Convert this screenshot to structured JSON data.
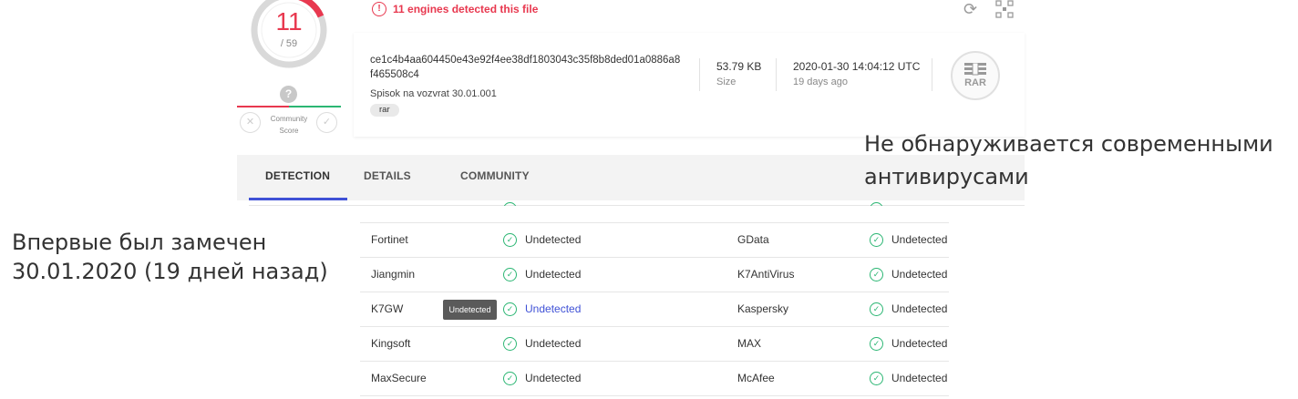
{
  "score": {
    "detected": "11",
    "total": "/ 59",
    "color": "#e8384f"
  },
  "community": {
    "icon": "question-icon",
    "label_line1": "Community",
    "label_line2": "Score"
  },
  "alert": {
    "text": "11 engines detected this file",
    "color": "#e8384f"
  },
  "file": {
    "hash_line1": "ce1c4b4aa604450e43e92f4ee38df1803043c35f8b8ded01a0886a8",
    "hash_line2": "f465508c4",
    "name": "Spisok na vozvrat 30.01.001",
    "tag": "rar",
    "size_value": "53.79 KB",
    "size_label": "Size",
    "date_value": "2020-01-30 14:04:12 UTC",
    "date_ago": "19 days ago",
    "type_icon_label": "RAR"
  },
  "tabs": [
    {
      "label": "DETECTION",
      "active": true
    },
    {
      "label": "DETAILS",
      "active": false
    },
    {
      "label": "COMMUNITY",
      "active": false
    }
  ],
  "results": [
    {
      "left_engine": "Fortinet",
      "left_result": "Undetected",
      "right_engine": "GData",
      "right_result": "Undetected"
    },
    {
      "left_engine": "Jiangmin",
      "left_result": "Undetected",
      "right_engine": "K7AntiVirus",
      "right_result": "Undetected"
    },
    {
      "left_engine": "K7GW",
      "left_result": "Undetected",
      "right_engine": "Kaspersky",
      "right_result": "Undetected"
    },
    {
      "left_engine": "Kingsoft",
      "left_result": "Undetected",
      "right_engine": "MAX",
      "right_result": "Undetected"
    },
    {
      "left_engine": "MaxSecure",
      "left_result": "Undetected",
      "right_engine": "McAfee",
      "right_result": "Undetected"
    }
  ],
  "tooltip": "Undetected",
  "captions": {
    "right_line1": "Не обнаруживается современными",
    "right_line2": "антивирусами",
    "left_line1": "Впервые был замечен",
    "left_line2": "30.01.2020 (19 дней назад)"
  },
  "colors": {
    "accent": "#3f51d6",
    "clean": "#2bb673",
    "malicious": "#e8384f"
  }
}
